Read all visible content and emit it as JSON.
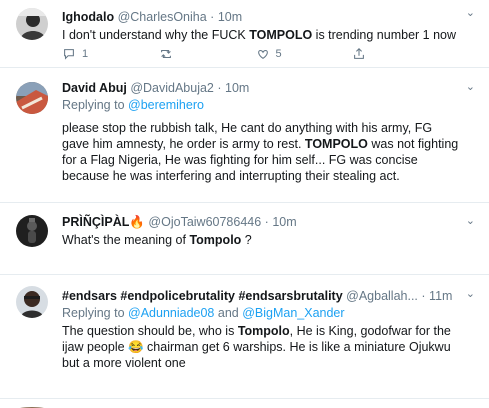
{
  "tweets": [
    {
      "name": "Ighodalo",
      "handle": "@CharlesOniha",
      "dot": "·",
      "time": "10m",
      "text_pre": "I don't understand why the FUCK ",
      "text_bold": "TOMPOLO",
      "text_post": " is trending number 1 now",
      "reply_count": "1",
      "retweet_count": "",
      "like_count": "5"
    },
    {
      "name": "David Abuj",
      "handle": "@DavidAbuja2",
      "dot": "·",
      "time": "10m",
      "replying_prefix": "Replying to ",
      "replying_to": "@beremihero",
      "text_pre": "please stop the rubbish talk, He cant do anything with his army, FG gave him amnesty, he order is army to rest. ",
      "text_bold": "TOMPOLO",
      "text_post": " was not fighting for a Flag Nigeria, He was fighting for him self... FG was concise because he was interfering and interrupting their stealing act."
    },
    {
      "name": "PRÌÑÇÌPÀL🔥",
      "handle": "@OjoTaiw60786446",
      "dot": "·",
      "time": "10m",
      "text_pre": "What's the meaning of ",
      "text_bold": "Tompolo",
      "text_post": " ?"
    },
    {
      "name": "#endsars #endpolicebrutality #endsarsbrutality",
      "handle": "@Agballah...",
      "dot": "·",
      "time": "11m",
      "replying_prefix": "Replying to ",
      "replying_to": "@Adunniade08",
      "replying_and": " and ",
      "replying_to2": "@BigMan_Xander",
      "text_pre": "The question should be, who is ",
      "text_bold": "Tompolo",
      "text_post": ", He is King, godofwar for the ijaw people 😂 chairman get 6 warships. He is like a miniature Ojukwu but a more violent one"
    }
  ],
  "chevron": "⌄"
}
